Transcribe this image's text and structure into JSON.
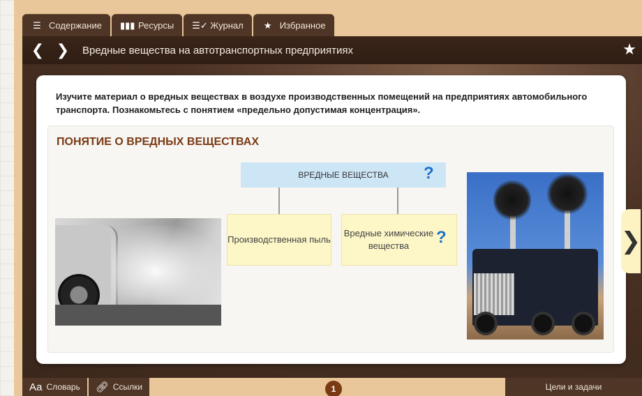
{
  "tabs": [
    {
      "label": "Содержание",
      "icon": "list-icon"
    },
    {
      "label": "Ресурсы",
      "icon": "bar-chart-icon"
    },
    {
      "label": "Журнал",
      "icon": "journal-check-icon"
    },
    {
      "label": "Избранное",
      "icon": "star-icon"
    }
  ],
  "titlebar": {
    "title": "Вредные вещества на автотранспортных предприятиях"
  },
  "content": {
    "intro": "Изучите материал о вредных веществах в воздухе производственных помещений на предприятиях автомобильного транспорта. Познакомьтесь с понятием «предельно допустимая концентрация».",
    "section_title": "ПОНЯТИЕ О ВРЕДНЫХ ВЕЩЕСТВАХ",
    "diagram": {
      "main": "ВРЕДНЫЕ ВЕЩЕСТВА",
      "left": "Производственная пыль",
      "right": "Вредные химические вещества",
      "help_mark": "?"
    }
  },
  "bottombar": {
    "glossary_icon_text": "Аа",
    "glossary": "Словарь",
    "links": "Ссылки",
    "page": "1",
    "goals": "Цели и задачи"
  },
  "colors": {
    "tab_bg": "#4e3525",
    "section_title": "#7a3a14",
    "help_mark": "#1e6fc8",
    "diagram_main_bg": "#cde6f6",
    "diagram_box_bg": "#fdf6c7"
  }
}
